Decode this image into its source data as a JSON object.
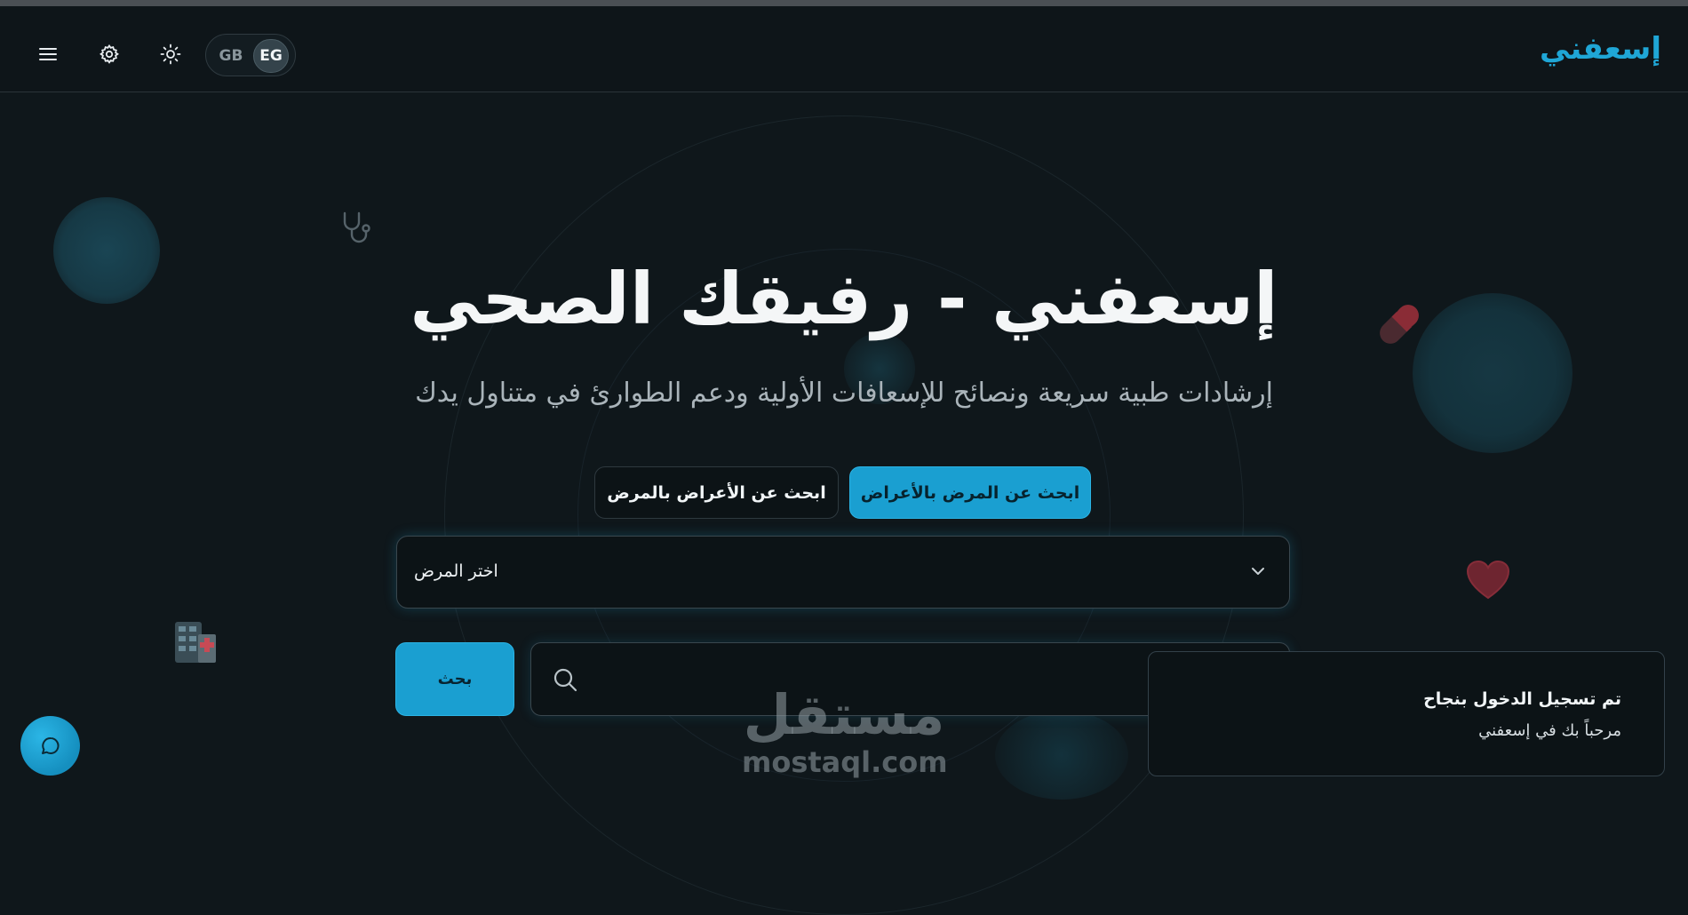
{
  "app": {
    "brand": "إسعفني"
  },
  "nav": {
    "lang_gb": "GB",
    "lang_eg": "EG",
    "active_lang": "EG"
  },
  "hero": {
    "title": "إسعفني - رفيقك الصحي",
    "subtitle": "إرشادات طبية سريعة ونصائح للإسعافات الأولية ودعم الطوارئ في متناول يدك"
  },
  "tabs": [
    {
      "label": "ابحث عن المرض بالأعراض",
      "active": true
    },
    {
      "label": "ابحث عن الأعراض بالمرض",
      "active": false
    }
  ],
  "form": {
    "select_placeholder": "اختر المرض",
    "search_button": "بحث",
    "search_value": ""
  },
  "toast": {
    "title": "تم تسجيل الدخول بنجاح",
    "message": "مرحباً بك في إسعفني"
  },
  "watermark": {
    "arabic": "مستقل",
    "latin": "mostaql.com"
  },
  "colors": {
    "accent": "#1a9fd1",
    "background": "#0f171b",
    "brand": "#1fa6d6"
  }
}
